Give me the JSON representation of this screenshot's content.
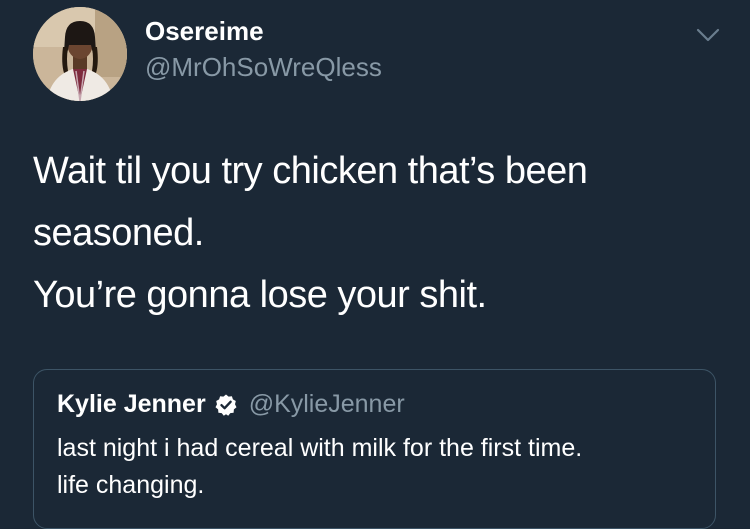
{
  "author": {
    "display_name": "Osereime",
    "handle": "@MrOhSoWreQless",
    "avatar_icon": "profile-photo"
  },
  "tweet": {
    "lines": [
      "Wait til you try chicken that’s been",
      "seasoned.",
      "You’re gonna lose your shit."
    ]
  },
  "menu_icon": "chevron-down-icon",
  "quoted_tweet": {
    "display_name": "Kylie Jenner",
    "verified": true,
    "verified_icon": "verified-badge-icon",
    "handle": "@KylieJenner",
    "lines": [
      "last night i had cereal with milk for the first time.",
      "life changing."
    ]
  },
  "colors": {
    "background": "#1b2836",
    "primary_text": "#ffffff",
    "secondary_text": "#8899a6",
    "card_border": "#3d5466"
  }
}
